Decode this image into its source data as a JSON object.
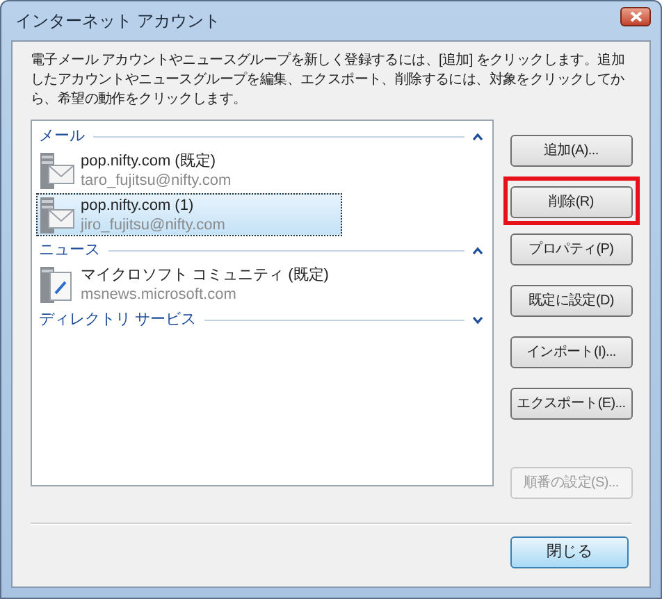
{
  "window": {
    "title": "インターネット アカウント"
  },
  "description": "電子メール アカウントやニュースグループを新しく登録するには、[追加] をクリックします。追加したアカウントやニュースグループを編集、エクスポート、削除するには、対象をクリックしてから、希望の動作をクリックします。",
  "sections": [
    {
      "title": "メール",
      "expanded": true,
      "items": [
        {
          "kind": "mail",
          "name": "pop.nifty.com (既定)",
          "detail": "taro_fujitsu@nifty.com",
          "selected": false
        },
        {
          "kind": "mail",
          "name": "pop.nifty.com (1)",
          "detail": "jiro_fujitsu@nifty.com",
          "selected": true
        }
      ]
    },
    {
      "title": "ニュース",
      "expanded": true,
      "items": [
        {
          "kind": "news",
          "name": "マイクロソフト コミュニティ (既定)",
          "detail": "msnews.microsoft.com",
          "selected": false
        }
      ]
    },
    {
      "title": "ディレクトリ サービス",
      "expanded": false
    }
  ],
  "buttons": [
    {
      "label": "追加(A)...",
      "disabled": false,
      "highlighted": false
    },
    {
      "label": "削除(R)",
      "disabled": false,
      "highlighted": true
    },
    {
      "label": "プロパティ(P)",
      "disabled": false,
      "highlighted": false
    },
    {
      "label": "既定に設定(D)",
      "disabled": false,
      "highlighted": false
    },
    {
      "label": "インポート(I)...",
      "disabled": false,
      "highlighted": false
    },
    {
      "label": "エクスポート(E)...",
      "disabled": false,
      "highlighted": false
    },
    {
      "label": "順番の設定(S)...",
      "disabled": true,
      "highlighted": false
    }
  ],
  "close_button": {
    "label": "閉じる"
  }
}
